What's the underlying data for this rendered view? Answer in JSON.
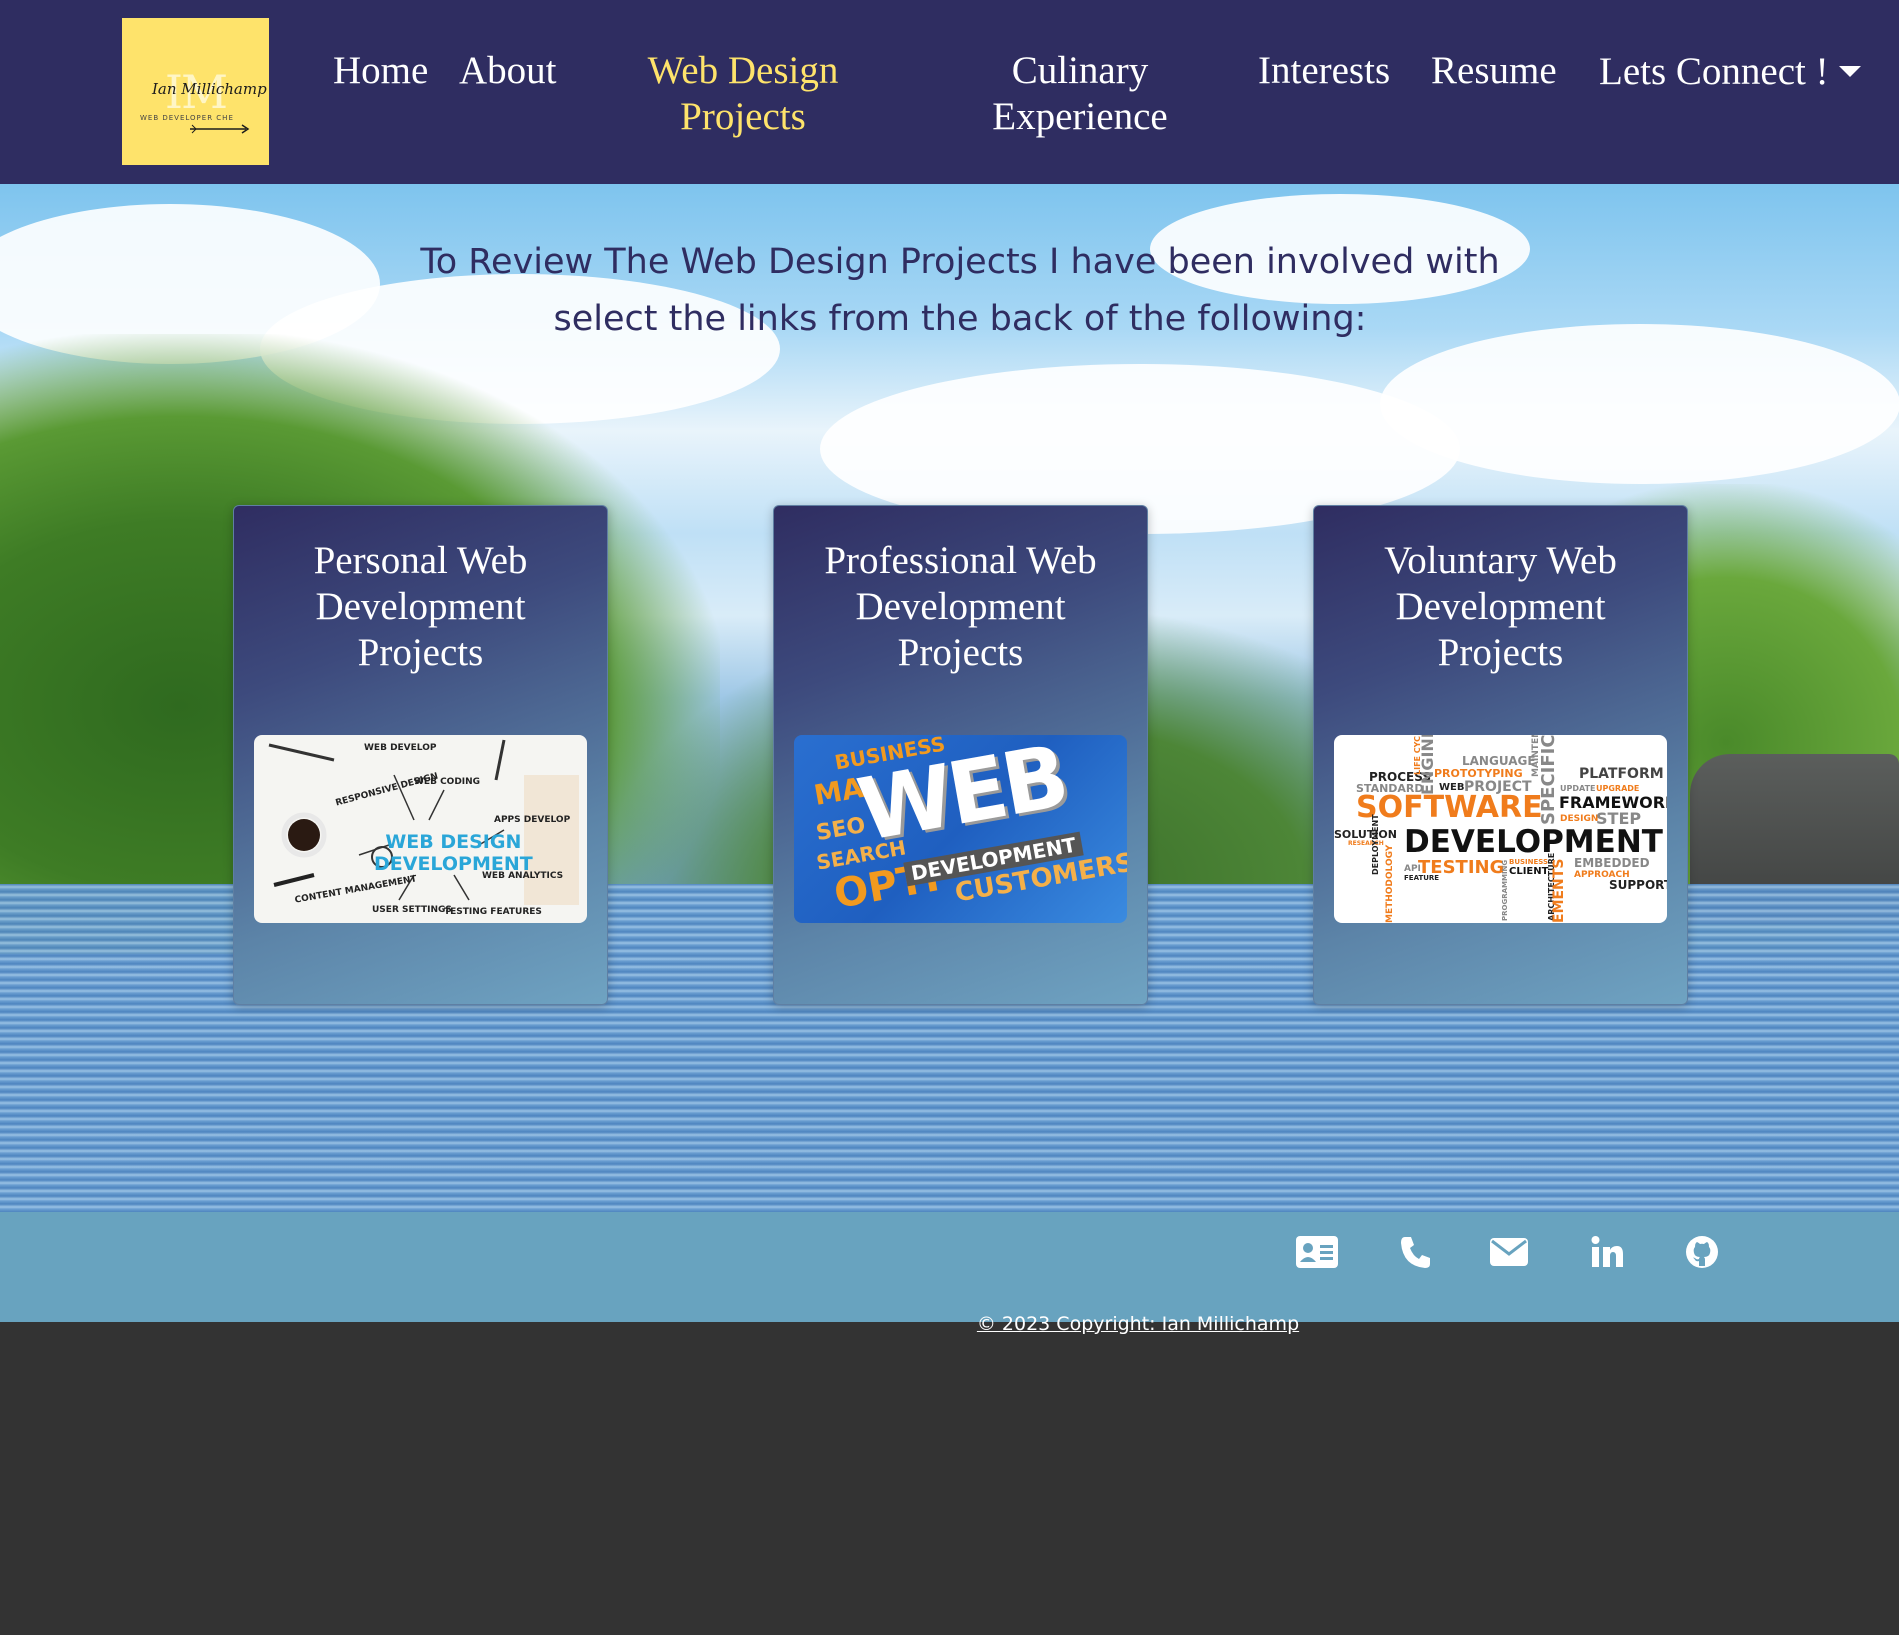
{
  "brand": {
    "initials": "IM",
    "script_name": "Ian Millichamp",
    "tagline": "WEB DEVELOPER CHE"
  },
  "nav": {
    "home": "Home",
    "about": "About",
    "web_design_line1": "Web Design",
    "web_design_line2": "Projects",
    "culinary_line1": "Culinary",
    "culinary_line2": "Experience",
    "interests": "Interests",
    "resume": "Resume",
    "connect": "Lets Connect !",
    "active_item": "Web Design Projects"
  },
  "intro": {
    "line1": "To Review The Web Design Projects I have been involved with",
    "line2": "select the links from the back of the following:"
  },
  "cards": [
    {
      "title_lines": [
        "Personal Web",
        "Development",
        "Projects"
      ],
      "image": {
        "center_line1": "WEB DESIGN",
        "center_line2": "DEVELOPMENT",
        "labels": [
          "WEB DEVELOP",
          "WEB CODING",
          "RESPONSIVE DESIGN",
          "APPS DEVELOP",
          "WEB ANALYTICS",
          "CONTENT MANAGEMENT",
          "USER SETTINGS",
          "TESTING FEATURES"
        ]
      }
    },
    {
      "title_lines": [
        "Professional Web",
        "Development",
        "Projects"
      ],
      "image": {
        "big": "WEB",
        "sub": "DEVELOPMENT",
        "words": [
          "BUSINESS",
          "MA",
          "SEO",
          "SEARCH",
          "OPTI",
          "CUSTOMERS"
        ]
      }
    },
    {
      "title_lines": [
        "Voluntary Web",
        "Development",
        "Projects"
      ],
      "image": {
        "words": [
          "PROCESS",
          "STANDARD",
          "WEB",
          "LANGUAGE",
          "PROTOTYPING",
          "PROJECT",
          "PLATFORM",
          "UPDATE",
          "UPGRADE",
          "SOFTWARE",
          "FRAMEWORK",
          "DESIGN",
          "STEP",
          "SOLUTION",
          "RESEARCH",
          "DEVELOPMENT",
          "API",
          "TESTING",
          "BUSINESS",
          "CLIENT",
          "EMBEDDED",
          "APPROACH",
          "SUPPORT",
          "FEATURE",
          "DEPLOYMENT",
          "METHODOLOGY",
          "ENGINE",
          "SPECIFIC",
          "ARCHITECTURE",
          "PROGRAMMING",
          "EMENTS",
          "LIFE CYC",
          "MAINTEN"
        ]
      }
    }
  ],
  "footer": {
    "social_icons": [
      "contact-card-icon",
      "phone-icon",
      "envelope-icon",
      "linkedin-icon",
      "github-icon"
    ],
    "copyright": "© 2023 Copyright: Ian Millichamp"
  },
  "colors": {
    "nav_bg": "#2f2d61",
    "accent_yellow": "#fee36b",
    "footer_bg": "#68a3bf",
    "page_bottom": "#333333",
    "intro_text": "#2f2d61"
  }
}
